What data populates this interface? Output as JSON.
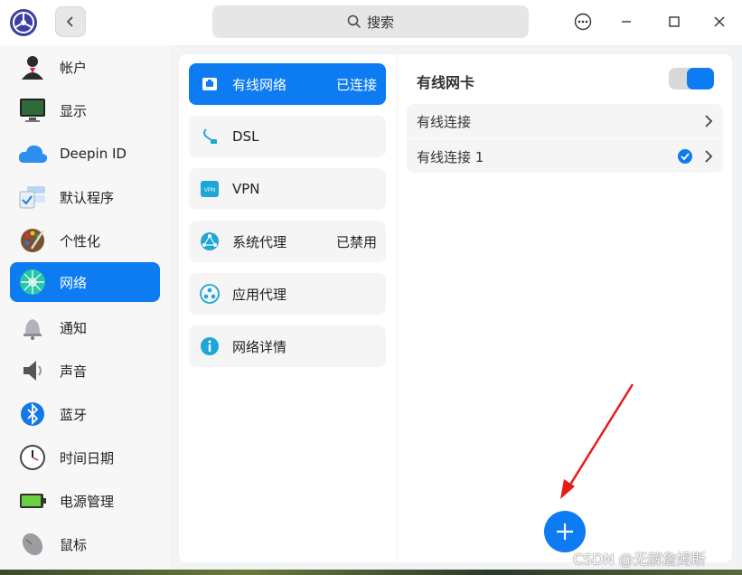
{
  "search": {
    "label": "搜索"
  },
  "sidebar": {
    "items": [
      {
        "label": "帐户",
        "icon": "user-avatar-icon"
      },
      {
        "label": "显示",
        "icon": "monitor-icon"
      },
      {
        "label": "Deepin ID",
        "icon": "cloud-icon"
      },
      {
        "label": "默认程序",
        "icon": "default-apps-icon"
      },
      {
        "label": "个性化",
        "icon": "palette-icon"
      },
      {
        "label": "网络",
        "icon": "network-icon"
      },
      {
        "label": "通知",
        "icon": "bell-icon"
      },
      {
        "label": "声音",
        "icon": "speaker-icon"
      },
      {
        "label": "蓝牙",
        "icon": "bluetooth-icon"
      },
      {
        "label": "时间日期",
        "icon": "clock-icon"
      },
      {
        "label": "电源管理",
        "icon": "battery-icon"
      },
      {
        "label": "鼠标",
        "icon": "mouse-icon"
      }
    ],
    "active_index": 5
  },
  "network_menu": {
    "items": [
      {
        "label": "有线网络",
        "status": "已连接",
        "icon": "wired-network-icon"
      },
      {
        "label": "DSL",
        "status": "",
        "icon": "dsl-icon"
      },
      {
        "label": "VPN",
        "status": "",
        "icon": "vpn-icon"
      },
      {
        "label": "系统代理",
        "status": "已禁用",
        "icon": "proxy-icon"
      },
      {
        "label": "应用代理",
        "status": "",
        "icon": "app-proxy-icon"
      },
      {
        "label": "网络详情",
        "status": "",
        "icon": "info-icon"
      }
    ]
  },
  "vpn_badge": "VPN",
  "wired_panel": {
    "title": "有线网卡",
    "enabled": true,
    "connections": [
      {
        "label": "有线连接",
        "checked": false
      },
      {
        "label": "有线连接 1",
        "checked": true
      }
    ]
  },
  "watermark": "CSDN @无解詹姆斯",
  "colors": {
    "accent": "#0d7bf2",
    "arrow": "#e81b1b"
  }
}
